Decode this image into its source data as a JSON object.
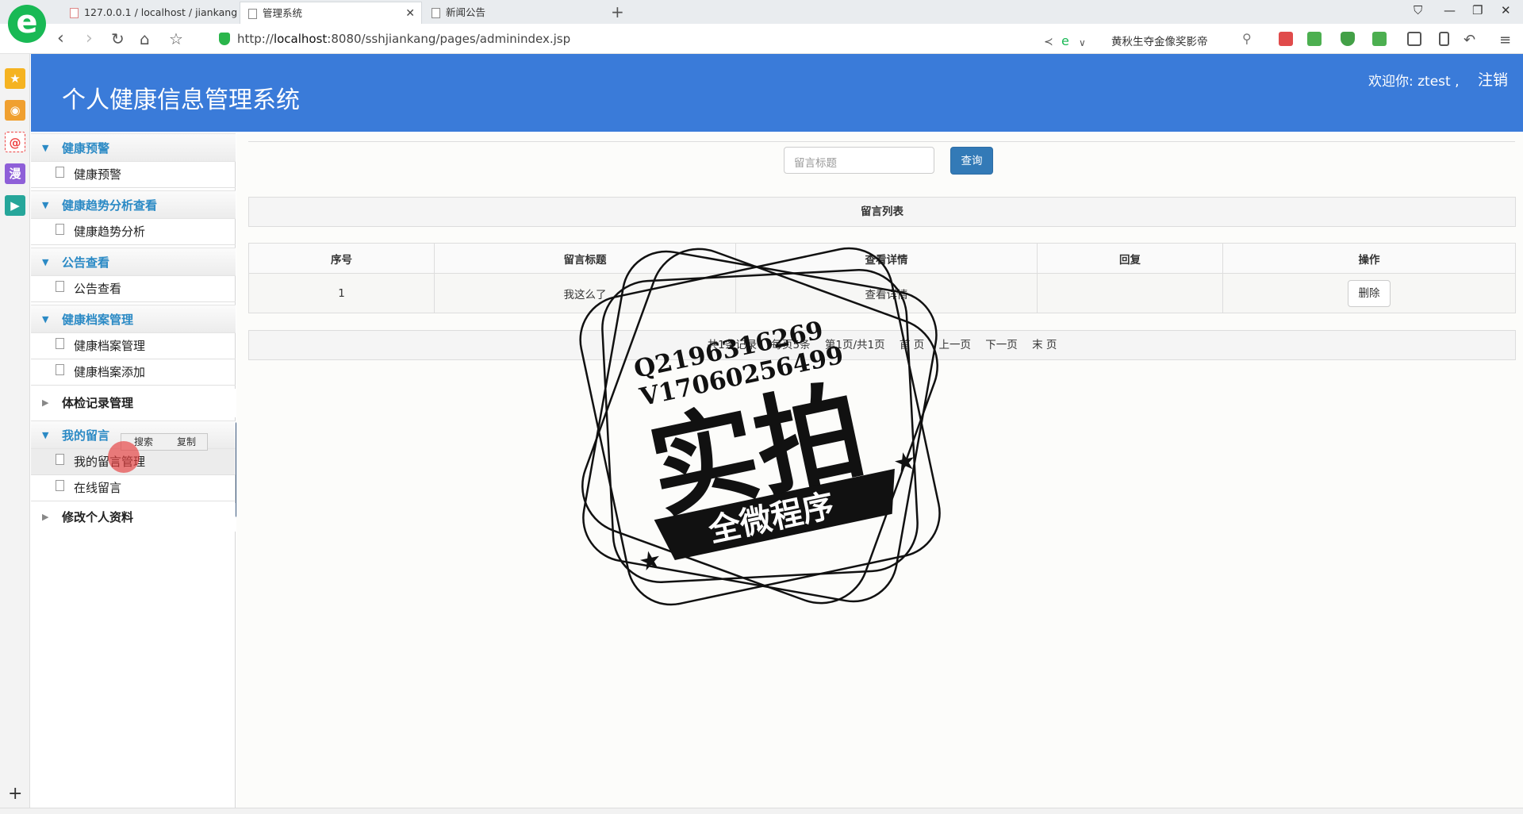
{
  "browser": {
    "tabs": [
      {
        "label": "127.0.0.1 / localhost / jiankang"
      },
      {
        "label": "管理系统"
      },
      {
        "label": "新闻公告"
      }
    ],
    "url_prefix": "http://",
    "url_host": "localhost",
    "url_rest": ":8080/sshjiankang/pages/adminindex.jsp",
    "search_text": "黄秋生夺金像奖影帝"
  },
  "header": {
    "title": "个人健康信息管理系统",
    "welcome": "欢迎你: ztest ,",
    "logout": "注销"
  },
  "menu": {
    "groups": [
      {
        "label": "健康预警",
        "items": [
          "健康预警"
        ]
      },
      {
        "label": "健康趋势分析查看",
        "items": [
          "健康趋势分析"
        ]
      },
      {
        "label": "公告查看",
        "items": [
          "公告查看"
        ]
      },
      {
        "label": "健康档案管理",
        "items": [
          "健康档案管理",
          "健康档案添加"
        ]
      },
      {
        "label": "体检记录管理"
      },
      {
        "label": "我的留言",
        "items": [
          "我的留言管理",
          "在线留言"
        ]
      },
      {
        "label": "修改个人资料"
      }
    ],
    "context": {
      "search": "搜索",
      "copy": "复制"
    }
  },
  "content": {
    "search_placeholder": "留言标题",
    "query_button": "查询",
    "panel_title": "留言列表",
    "table": {
      "headers": [
        "序号",
        "留言标题",
        "查看详情",
        "回复",
        "操作"
      ],
      "rows": [
        {
          "index": "1",
          "title": "我这么了",
          "detail": "查看详情",
          "reply": "",
          "action": "删除"
        }
      ]
    },
    "pager": {
      "total": "共1条记录",
      "per_page": "每页5条",
      "page": "第1页/共1页",
      "first": "首 页",
      "prev": "上一页",
      "next": "下一页",
      "last": "末 页"
    }
  },
  "watermark": {
    "line1": "Q2196316269",
    "line2": "V17060256499",
    "big": "实拍",
    "banner": "全微程序"
  },
  "colors": {
    "header": "#3a7bd9",
    "accent": "#2b8ac5",
    "button": "#337ab7"
  }
}
